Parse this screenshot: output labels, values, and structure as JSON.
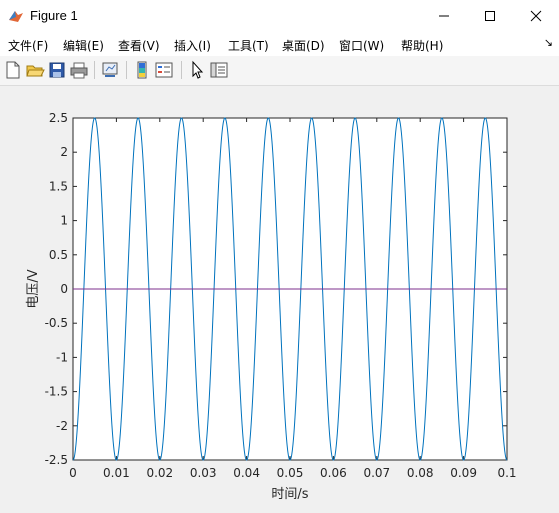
{
  "window": {
    "title": "Figure 1",
    "minimize_icon": "minimize-icon",
    "maximize_icon": "maximize-icon",
    "close_icon": "close-icon"
  },
  "menu": {
    "items": [
      "文件(F)",
      "编辑(E)",
      "查看(V)",
      "插入(I)",
      "工具(T)",
      "桌面(D)",
      "窗口(W)",
      "帮助(H)"
    ],
    "dock_arrow": "↘"
  },
  "toolbar": {
    "icons": [
      "new-figure-icon",
      "open-file-icon",
      "save-icon",
      "print-icon",
      "link-plot-icon",
      "colorbar-icon",
      "legend-icon",
      "pointer-icon",
      "property-inspector-icon"
    ]
  },
  "colors": {
    "sine": "#0072bd",
    "zero_line": "#7e2f8e",
    "axes_bg": "#ffffff"
  },
  "chart_data": {
    "type": "line",
    "xlabel": "时间/s",
    "ylabel": "电压/V",
    "xlim": [
      0,
      0.1
    ],
    "ylim": [
      -2.5,
      2.5
    ],
    "xticks": [
      "0",
      "0.01",
      "0.02",
      "0.03",
      "0.04",
      "0.05",
      "0.06",
      "0.07",
      "0.08",
      "0.09",
      "0.1"
    ],
    "yticks": [
      "2.5",
      "2",
      "1.5",
      "1",
      "0.5",
      "0",
      "-0.5",
      "-1",
      "-1.5",
      "-2",
      "-2.5"
    ],
    "grid": false,
    "series": [
      {
        "amplitude": 2.5,
        "frequency_hz": 100,
        "phase_rad": -1.5708,
        "x_range": [
          0,
          0.1
        ]
      },
      {
        "constant": 0,
        "x_range": [
          0,
          0.1
        ]
      }
    ]
  }
}
